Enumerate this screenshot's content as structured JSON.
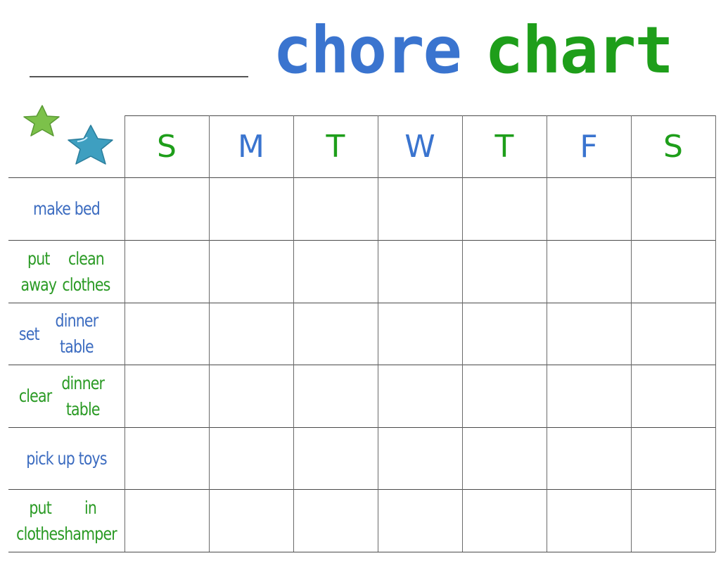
{
  "title": {
    "word1": "chore",
    "word2": "chart",
    "word1_color": "#3a74cf",
    "word2_color": "#1e9e1a"
  },
  "name_field": {
    "value": ""
  },
  "decorations": {
    "icons": [
      "green-star-icon",
      "blue-star-icon"
    ]
  },
  "days": [
    {
      "label": "S",
      "color": "green"
    },
    {
      "label": "M",
      "color": "blue"
    },
    {
      "label": "T",
      "color": "green"
    },
    {
      "label": "W",
      "color": "blue"
    },
    {
      "label": "T",
      "color": "green"
    },
    {
      "label": "F",
      "color": "blue"
    },
    {
      "label": "S",
      "color": "green"
    }
  ],
  "chores": [
    {
      "label": "make bed",
      "color": "blue"
    },
    {
      "label": "put away\nclean clothes",
      "color": "green"
    },
    {
      "label": "set\ndinner table",
      "color": "blue"
    },
    {
      "label": "clear\ndinner table",
      "color": "green"
    },
    {
      "label": "pick up toys",
      "color": "blue"
    },
    {
      "label": "put clothes\nin hamper",
      "color": "green"
    }
  ],
  "grid": {
    "cells_checked": [
      [
        false,
        false,
        false,
        false,
        false,
        false,
        false
      ],
      [
        false,
        false,
        false,
        false,
        false,
        false,
        false
      ],
      [
        false,
        false,
        false,
        false,
        false,
        false,
        false
      ],
      [
        false,
        false,
        false,
        false,
        false,
        false,
        false
      ],
      [
        false,
        false,
        false,
        false,
        false,
        false,
        false
      ],
      [
        false,
        false,
        false,
        false,
        false,
        false,
        false
      ]
    ]
  }
}
